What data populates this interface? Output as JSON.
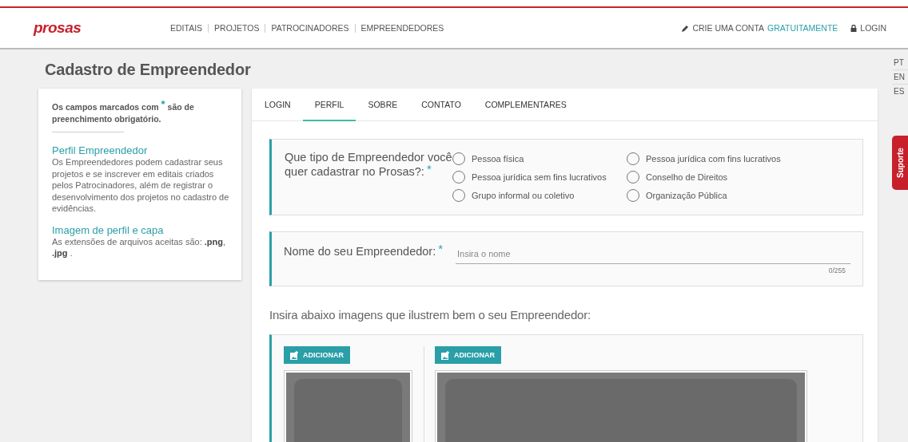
{
  "header": {
    "logo": "prosas",
    "nav": [
      {
        "label": "EDITAIS"
      },
      {
        "label": "PROJETOS"
      },
      {
        "label": "PATROCINADORES"
      },
      {
        "label": "EMPREENDEDORES"
      }
    ],
    "create_account": {
      "text": "CRIE UMA CONTA",
      "link": "GRATUITAMENTE"
    },
    "login": "LOGIN"
  },
  "title": "Cadastro de Empreendedor",
  "sidebar": {
    "note": "Os campos marcados com $^{*}$ são de preenchimento obrigatório.",
    "sections": [
      {
        "heading": "Perfil Empreendedor",
        "text": "Os Empreendedores podem cadastrar seus projetos e se inscrever em editais criados pelos Patrocinadores, além de registrar o desenvolvimento dos projetos no cadastro de evidências."
      },
      {
        "heading": "Imagem de perfil e capa",
        "text": "As extensões de arquivos aceitas são: **.png**, **.jpg** ."
      }
    ]
  },
  "tabs": [
    {
      "label": "LOGIN",
      "selected": false
    },
    {
      "label": "PERFIL",
      "selected": true
    },
    {
      "label": "SOBRE",
      "selected": false
    },
    {
      "label": "CONTATO",
      "selected": false
    },
    {
      "label": "COMPLEMENTARES",
      "selected": false
    }
  ],
  "question": {
    "label": "Que tipo de Empreendedor você quer cadastrar no Prosas?:",
    "required_mark": "*",
    "options": [
      {
        "label": "Pessoa física",
        "selected": false
      },
      {
        "label": "Pessoa jurídica com fins lucrativos",
        "selected": false
      },
      {
        "label": "Pessoa jurídica sem fins lucrativos",
        "selected": false
      },
      {
        "label": "Conselho de Direitos",
        "selected": false
      },
      {
        "label": "Grupo informal ou coletivo",
        "selected": false
      },
      {
        "label": "Organização Pública",
        "selected": false
      }
    ]
  },
  "name_field": {
    "label": "Nome do seu Empreendedor:",
    "required_mark": "*",
    "placeholder": "Insira o nome",
    "counter": "0/255"
  },
  "images_prompt": "Insira abaixo imagens que ilustrem bem o seu Empreendedor:",
  "uploads": [
    {
      "button": "ADICIONAR",
      "kind": "profile"
    },
    {
      "button": "ADICIONAR",
      "kind": "cover"
    }
  ],
  "languages": [
    {
      "label": "PT"
    },
    {
      "label": "EN"
    },
    {
      "label": "ES"
    }
  ],
  "support": "Suporte"
}
